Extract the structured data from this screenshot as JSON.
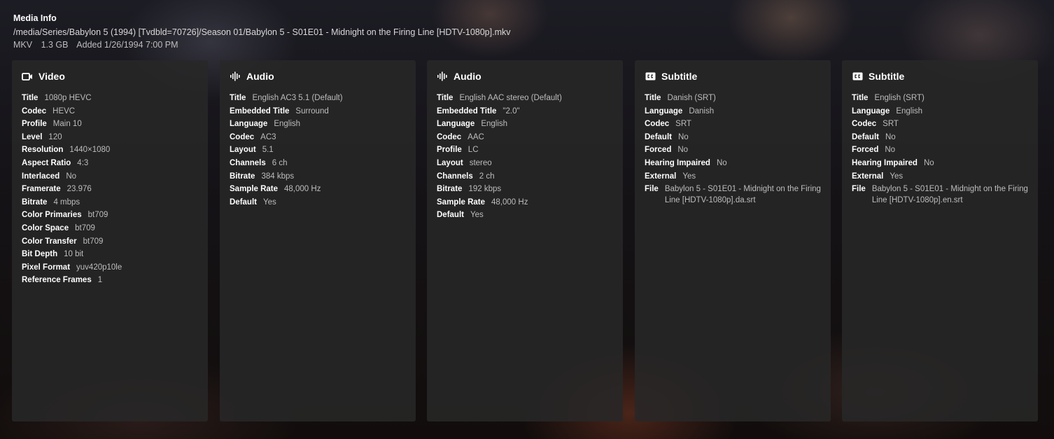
{
  "header": {
    "title": "Media Info",
    "path": "/media/Series/Babylon 5 (1994) [Tvdbld=70726]/Season 01/Babylon 5 - S01E01 - Midnight on the Firing Line [HDTV-1080p].mkv",
    "container": "MKV",
    "size": "1.3 GB",
    "added": "Added 1/26/1994 7:00 PM"
  },
  "streams": [
    {
      "type": "Video",
      "icon": "video-camera-icon",
      "rows": [
        {
          "k": "Title",
          "v": "1080p HEVC"
        },
        {
          "k": "Codec",
          "v": "HEVC"
        },
        {
          "k": "Profile",
          "v": "Main 10"
        },
        {
          "k": "Level",
          "v": "120"
        },
        {
          "k": "Resolution",
          "v": "1440×1080"
        },
        {
          "k": "Aspect Ratio",
          "v": "4:3"
        },
        {
          "k": "Interlaced",
          "v": "No"
        },
        {
          "k": "Framerate",
          "v": "23.976"
        },
        {
          "k": "Bitrate",
          "v": "4 mbps"
        },
        {
          "k": "Color Primaries",
          "v": "bt709"
        },
        {
          "k": "Color Space",
          "v": "bt709"
        },
        {
          "k": "Color Transfer",
          "v": "bt709"
        },
        {
          "k": "Bit Depth",
          "v": "10 bit"
        },
        {
          "k": "Pixel Format",
          "v": "yuv420p10le"
        },
        {
          "k": "Reference Frames",
          "v": "1"
        }
      ]
    },
    {
      "type": "Audio",
      "icon": "audio-waveform-icon",
      "rows": [
        {
          "k": "Title",
          "v": "English AC3 5.1 (Default)"
        },
        {
          "k": "Embedded Title",
          "v": "Surround"
        },
        {
          "k": "Language",
          "v": "English"
        },
        {
          "k": "Codec",
          "v": "AC3"
        },
        {
          "k": "Layout",
          "v": "5.1"
        },
        {
          "k": "Channels",
          "v": "6 ch"
        },
        {
          "k": "Bitrate",
          "v": "384 kbps"
        },
        {
          "k": "Sample Rate",
          "v": "48,000 Hz"
        },
        {
          "k": "Default",
          "v": "Yes"
        }
      ]
    },
    {
      "type": "Audio",
      "icon": "audio-waveform-icon",
      "rows": [
        {
          "k": "Title",
          "v": "English AAC stereo (Default)"
        },
        {
          "k": "Embedded Title",
          "v": "\"2.0\""
        },
        {
          "k": "Language",
          "v": "English"
        },
        {
          "k": "Codec",
          "v": "AAC"
        },
        {
          "k": "Profile",
          "v": "LC"
        },
        {
          "k": "Layout",
          "v": "stereo"
        },
        {
          "k": "Channels",
          "v": "2 ch"
        },
        {
          "k": "Bitrate",
          "v": "192 kbps"
        },
        {
          "k": "Sample Rate",
          "v": "48,000 Hz"
        },
        {
          "k": "Default",
          "v": "Yes"
        }
      ]
    },
    {
      "type": "Subtitle",
      "icon": "closed-captions-icon",
      "rows": [
        {
          "k": "Title",
          "v": "Danish (SRT)"
        },
        {
          "k": "Language",
          "v": "Danish"
        },
        {
          "k": "Codec",
          "v": "SRT"
        },
        {
          "k": "Default",
          "v": "No"
        },
        {
          "k": "Forced",
          "v": "No"
        },
        {
          "k": "Hearing Impaired",
          "v": "No"
        },
        {
          "k": "External",
          "v": "Yes"
        },
        {
          "k": "File",
          "v": "Babylon 5 - S01E01 - Midnight on the Firing Line [HDTV-1080p].da.srt"
        }
      ]
    },
    {
      "type": "Subtitle",
      "icon": "closed-captions-icon",
      "rows": [
        {
          "k": "Title",
          "v": "English (SRT)"
        },
        {
          "k": "Language",
          "v": "English"
        },
        {
          "k": "Codec",
          "v": "SRT"
        },
        {
          "k": "Default",
          "v": "No"
        },
        {
          "k": "Forced",
          "v": "No"
        },
        {
          "k": "Hearing Impaired",
          "v": "No"
        },
        {
          "k": "External",
          "v": "Yes"
        },
        {
          "k": "File",
          "v": "Babylon 5 - S01E01 - Midnight on the Firing Line [HDTV-1080p].en.srt"
        }
      ]
    }
  ]
}
